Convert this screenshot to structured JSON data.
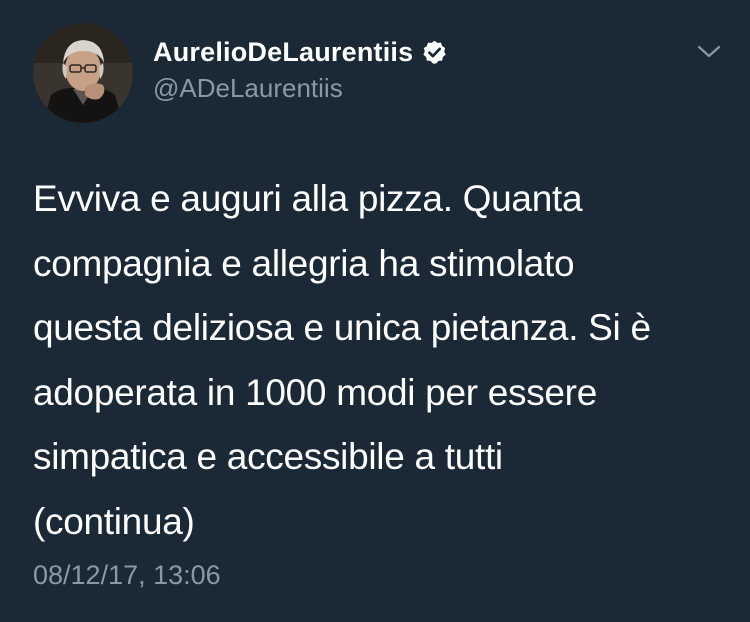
{
  "tweet": {
    "author": {
      "display_name": "AurelioDeLaurentiis",
      "handle": "@ADeLaurentiis",
      "verified": true,
      "avatar_icon": "profile-photo"
    },
    "menu_icon": "chevron-down-icon",
    "text_lines": [
      "Evviva e auguri alla pizza. Quanta",
      "compagnia e allegria ha stimolato",
      "questa deliziosa e unica pietanza. Si è",
      "adoperata in 1000 modi per essere",
      "simpatica e accessibile a tutti",
      "(continua)"
    ],
    "timestamp": "08/12/17, 13:06"
  },
  "colors": {
    "background": "#1b2836",
    "text": "#ffffff",
    "secondary_text": "#8899a6",
    "verified_badge": "#ffffff"
  }
}
